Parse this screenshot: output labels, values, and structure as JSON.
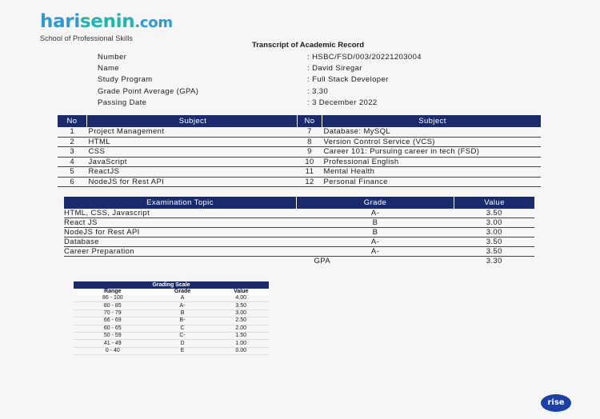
{
  "logo": {
    "part1": "hari",
    "part2": "senin",
    "part3": ".com",
    "tagline": "School of Professional Skills"
  },
  "title": "Transcript of Academic Record",
  "info": [
    {
      "label": "Number",
      "value": ": HSBC/FSD/003/20221203004"
    },
    {
      "label": "Name",
      "value": ": David Siregar"
    },
    {
      "label": "Study Program",
      "value": ": Full Stack Developer"
    },
    {
      "label": "Grade Point Average (GPA)",
      "value": ": 3.30"
    },
    {
      "label": "Passing Date",
      "value": ": 3 December 2022"
    }
  ],
  "subjects": {
    "headers": [
      "No",
      "Subject",
      "No",
      "Subject"
    ],
    "rows": [
      [
        "1",
        "Project Management",
        "7",
        "Database: MySQL"
      ],
      [
        "2",
        "HTML",
        "8",
        "Version Control Service (VCS)"
      ],
      [
        "3",
        "CSS",
        "9",
        "Career 101: Pursuing career in tech (FSD)"
      ],
      [
        "4",
        "JavaScript",
        "10",
        "Professional English"
      ],
      [
        "5",
        "ReactJS",
        "11",
        "Mental Health"
      ],
      [
        "6",
        "NodeJS for Rest API",
        "12",
        "Personal Finance"
      ]
    ]
  },
  "exam": {
    "headers": [
      "Examination Topic",
      "Grade",
      "Value"
    ],
    "rows": [
      [
        "HTML, CSS, Javascript",
        "A-",
        "3.50"
      ],
      [
        "React JS",
        "B",
        "3.00"
      ],
      [
        "NodeJS for Rest API",
        "B",
        "3.00"
      ],
      [
        "Database",
        "A-",
        "3.50"
      ],
      [
        "Career Preparation",
        "A-",
        "3.50"
      ]
    ],
    "gpa_label": "GPA",
    "gpa_value": "3.30"
  },
  "grading": {
    "caption": "Grading Scale",
    "headers": [
      "Range",
      "Grade",
      "Value"
    ],
    "rows": [
      [
        "86 - 100",
        "A",
        "4.00"
      ],
      [
        "80 - 85",
        "A-",
        "3.50"
      ],
      [
        "70 - 79",
        "B",
        "3.00"
      ],
      [
        "66 - 69",
        "B-",
        "2.50"
      ],
      [
        "60 - 65",
        "C",
        "2.00"
      ],
      [
        "50 - 59",
        "C-",
        "1.50"
      ],
      [
        "41 - 49",
        "D",
        "1.00"
      ],
      [
        "0 - 40",
        "E",
        "0.00"
      ]
    ]
  },
  "badge": "rise"
}
